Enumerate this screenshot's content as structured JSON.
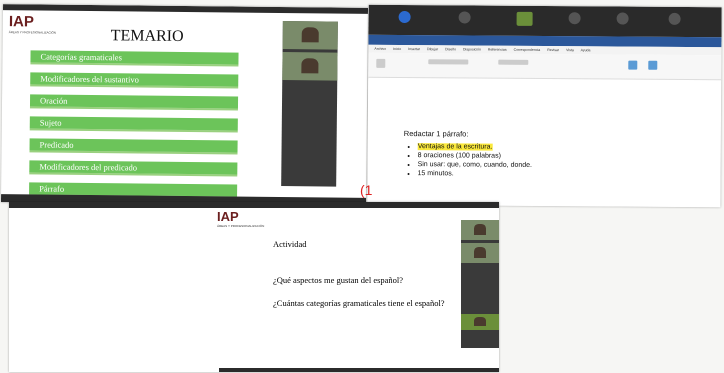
{
  "slide1": {
    "logo": "IAP",
    "logo_sub": "ÁREAS Y PROFESIONALIZACIÓN",
    "title": "TEMARIO",
    "items": [
      "Categorías gramaticales",
      "Modificadores del sustantivo",
      "Oración",
      "Sujeto",
      "Predicado",
      "Modificadores del predicado",
      "Párrafo"
    ]
  },
  "word": {
    "menu": [
      "Archivo",
      "Inicio",
      "Insertar",
      "Dibujar",
      "Diseño",
      "Disposición",
      "Referencias",
      "Correspondencia",
      "Revisar",
      "Vista",
      "Ayuda"
    ],
    "heading": "Redactar 1 párrafo:",
    "bullets": [
      "Ventajas de la escritura.",
      "8 oraciones (100 palabras)",
      "Sin usar: que, como, cuando, donde.",
      "15 minutos."
    ]
  },
  "marker": "(1",
  "slide3": {
    "logo": "IAP",
    "logo_sub": "ÁREAS Y PROFESIONALIZACIÓN",
    "heading": "Actividad",
    "q1": "¿Qué aspectos me gustan del español?",
    "q2": "¿Cuántas categorías gramaticales tiene el español?"
  },
  "colors": {
    "green_bar": "#6cc45a",
    "highlight": "#fbe93b",
    "logo": "#6b1f1f"
  }
}
